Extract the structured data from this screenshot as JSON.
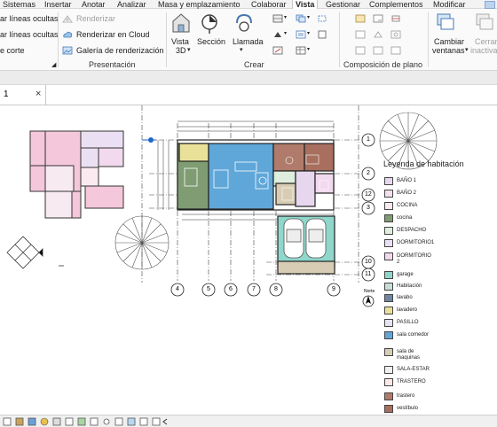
{
  "menu": {
    "tabs": [
      "Sistemas",
      "Insertar",
      "Anotar",
      "Analizar",
      "Masa y emplazamiento",
      "Colaborar",
      "Vista",
      "Gestionar",
      "Complementos",
      "Modificar"
    ],
    "active": "Vista"
  },
  "ribbon": {
    "left_items": [
      "ar líneas ocultas",
      "ar líneas ocultas",
      "e corte"
    ],
    "render": "Renderizar",
    "render_cloud": "Renderizar  en Cloud",
    "render_gallery": "Galería  de  renderización",
    "presentation_title": "Presentación",
    "vista3d": "Vista",
    "vista3d_2": "3D",
    "seccion": "Sección",
    "llamada": "Llamada",
    "crear_title": "Crear",
    "composicion_title": "Composición de plano",
    "cambiar": "Cambiar",
    "ventanas": "ventanas",
    "cerrar": "Cerrar",
    "inactivas": "inactivas"
  },
  "view_tab": {
    "label": "1",
    "close": "×"
  },
  "drawing": {
    "grid_top": [
      "1",
      "2",
      "12",
      "3",
      "10",
      "11"
    ],
    "grid_bottom": [
      "4",
      "5",
      "6",
      "7",
      "8",
      "9"
    ],
    "north": "Norte"
  },
  "legend": {
    "title": "Leyenda de habitación",
    "items": [
      {
        "label": "BAÑO 1",
        "color": "#e6d6ee"
      },
      {
        "label": "BAÑO 2",
        "color": "#f3dfee"
      },
      {
        "label": "COCINA",
        "color": "#fbeaf0"
      },
      {
        "label": "cocina",
        "color": "#7f9c72"
      },
      {
        "label": "DESPACHO",
        "color": "#dfeedd"
      },
      {
        "label": "DORMITORIO1",
        "color": "#ebe0f3"
      },
      {
        "label": "DORMITORIO 2",
        "color": "#f2d9ee"
      },
      {
        "label": "garage",
        "color": "#8fd6cb"
      },
      {
        "label": "Habitación",
        "color": "#c9ded4"
      },
      {
        "label": "lavabo",
        "color": "#6f86a0"
      },
      {
        "label": "lavadero",
        "color": "#e9e199"
      },
      {
        "label": "PASILLO",
        "color": "#e8e3f3"
      },
      {
        "label": "sala comedor",
        "color": "#5fa7d9"
      },
      {
        "label": "sala de maquinas",
        "color": "#d8cdb4"
      },
      {
        "label": "SALA-ESTAR",
        "color": "#f0f0f0"
      },
      {
        "label": "TRASTERO",
        "color": "#fde9e6"
      },
      {
        "label": "trastero",
        "color": "#b07b6a"
      },
      {
        "label": "vestíbulo",
        "color": "#a86f5e"
      }
    ]
  },
  "colors": {
    "accent": "#1e66c8"
  }
}
